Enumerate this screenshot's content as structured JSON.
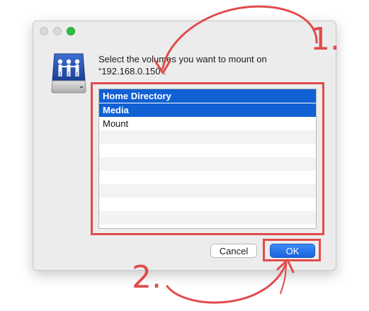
{
  "window": {
    "prompt_line1": "Select the volumes you want to mount on",
    "prompt_line2": "“192.168.0.150”:"
  },
  "volumes": [
    {
      "label": "Home Directory",
      "selected": true
    },
    {
      "label": "Media",
      "selected": true
    },
    {
      "label": "Mount",
      "selected": false
    }
  ],
  "buttons": {
    "cancel": "Cancel",
    "ok": "OK"
  },
  "annotations": {
    "step1": "1.",
    "step2": "2.",
    "color": "#e14b4b"
  },
  "colors": {
    "selection": "#1160d4",
    "window_bg": "#ececec",
    "maximize": "#29c23f"
  },
  "icons": {
    "server": "shared-server-icon"
  }
}
